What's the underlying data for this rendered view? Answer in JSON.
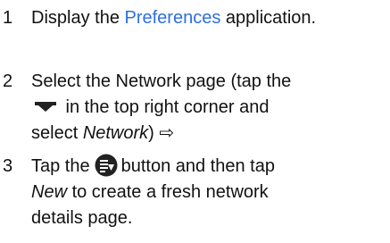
{
  "steps": [
    {
      "number": "1",
      "line1_pre": "Display the ",
      "link_text": "Preferences",
      "line1_post": " application."
    },
    {
      "number": "2",
      "line1_pre": "Select the Network page (tap the",
      "line2_post": " in the top right corner and",
      "line3_pre": "select ",
      "line3_em": "Network",
      "line3_post": ") ⇨"
    },
    {
      "number": "3",
      "line1_pre": "Tap the",
      "line1_post": "button and then tap",
      "line2_em": "New",
      "line2_post": " to create a fresh network",
      "line3": "details page."
    }
  ],
  "colors": {
    "link": "#2d6fe0",
    "text": "#111111",
    "icon": "#222222"
  },
  "icons": {
    "menu": "menu-triangle-icon",
    "button": "round-menu-button-icon",
    "arrow": "next-page-arrow-icon"
  }
}
